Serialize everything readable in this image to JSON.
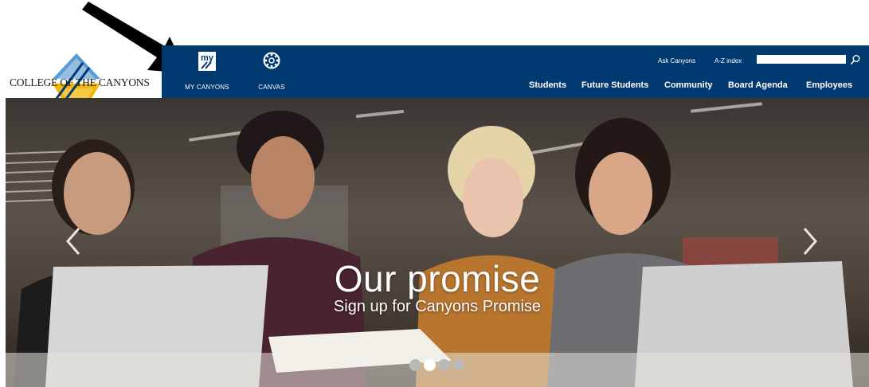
{
  "logo": {
    "text": "COLLEGE OF THE CANYONS"
  },
  "quick_links": [
    {
      "label": "MY CANYONS",
      "icon": "my-canyons-icon",
      "icon_text": "my"
    },
    {
      "label": "CANVAS",
      "icon": "canvas-icon"
    }
  ],
  "utility": {
    "ask": "Ask Canyons",
    "az": "A-Z index",
    "search_value": ""
  },
  "nav": {
    "students": "Students",
    "future": "Future Students",
    "community": "Community",
    "board": "Board Agenda",
    "employees": "Employees"
  },
  "hero": {
    "title": "Our promise",
    "subtitle": "Sign up for Canyons Promise",
    "slide_count": 4,
    "active_slide": 2
  },
  "colors": {
    "brand_blue": "#003a70",
    "gold": "#f2b705",
    "sky": "#5b9bd5"
  }
}
